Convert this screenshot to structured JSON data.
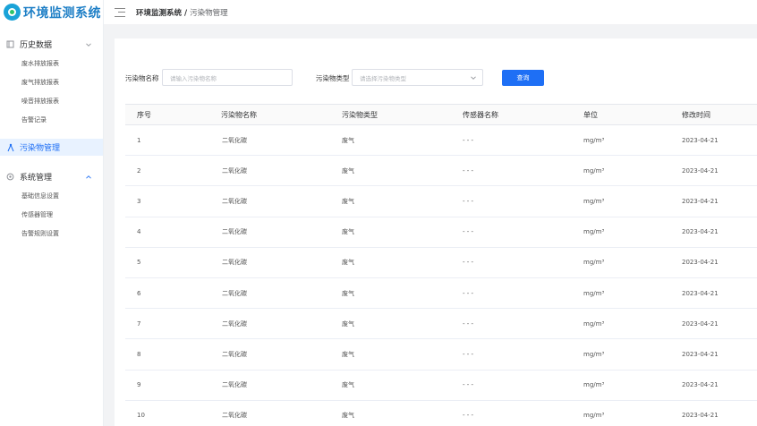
{
  "app": {
    "title": "环境监测系统"
  },
  "breadcrumb": {
    "root": "环境监测系统",
    "separator": "/",
    "current": "污染物管理"
  },
  "sidebar": {
    "groups": [
      {
        "label": "历史数据",
        "items": [
          "废水排放报表",
          "废气排放报表",
          "噪音排放报表",
          "告警记录"
        ]
      },
      {
        "label": "污染物管理",
        "active": true
      },
      {
        "label": "系统管理",
        "items": [
          "基础信息设置",
          "传感器管理",
          "告警规则设置"
        ]
      }
    ]
  },
  "filter": {
    "name_label": "污染物名称",
    "name_placeholder": "请输入污染物名称",
    "type_label": "污染物类型",
    "type_placeholder": "请选择污染物类型",
    "query_button": "查询"
  },
  "table": {
    "headers": [
      "序号",
      "污染物名称",
      "污染物类型",
      "传感器名称",
      "单位",
      "修改时间"
    ],
    "rows": [
      [
        "1",
        "二氧化碳",
        "废气",
        "- - -",
        "mg/m³",
        "2023-04-21"
      ],
      [
        "2",
        "二氧化碳",
        "废气",
        "- - -",
        "mg/m³",
        "2023-04-21"
      ],
      [
        "3",
        "二氧化碳",
        "废气",
        "- - -",
        "mg/m³",
        "2023-04-21"
      ],
      [
        "4",
        "二氧化碳",
        "废气",
        "- - -",
        "mg/m³",
        "2023-04-21"
      ],
      [
        "5",
        "二氧化碳",
        "废气",
        "- - -",
        "mg/m³",
        "2023-04-21"
      ],
      [
        "6",
        "二氧化碳",
        "废气",
        "- - -",
        "mg/m³",
        "2023-04-21"
      ],
      [
        "7",
        "二氧化碳",
        "废气",
        "- - -",
        "mg/m³",
        "2023-04-21"
      ],
      [
        "8",
        "二氧化碳",
        "废气",
        "- - -",
        "mg/m³",
        "2023-04-21"
      ],
      [
        "9",
        "二氧化碳",
        "废气",
        "- - -",
        "mg/m³",
        "2023-04-21"
      ],
      [
        "10",
        "二氧化碳",
        "废气",
        "- - -",
        "mg/m³",
        "2023-04-21"
      ]
    ]
  },
  "colors": {
    "primary": "#1e6ff5",
    "logo": "#1e7fc6",
    "active_bg": "#e8f2ff",
    "page_bg": "#f2f3f5"
  }
}
